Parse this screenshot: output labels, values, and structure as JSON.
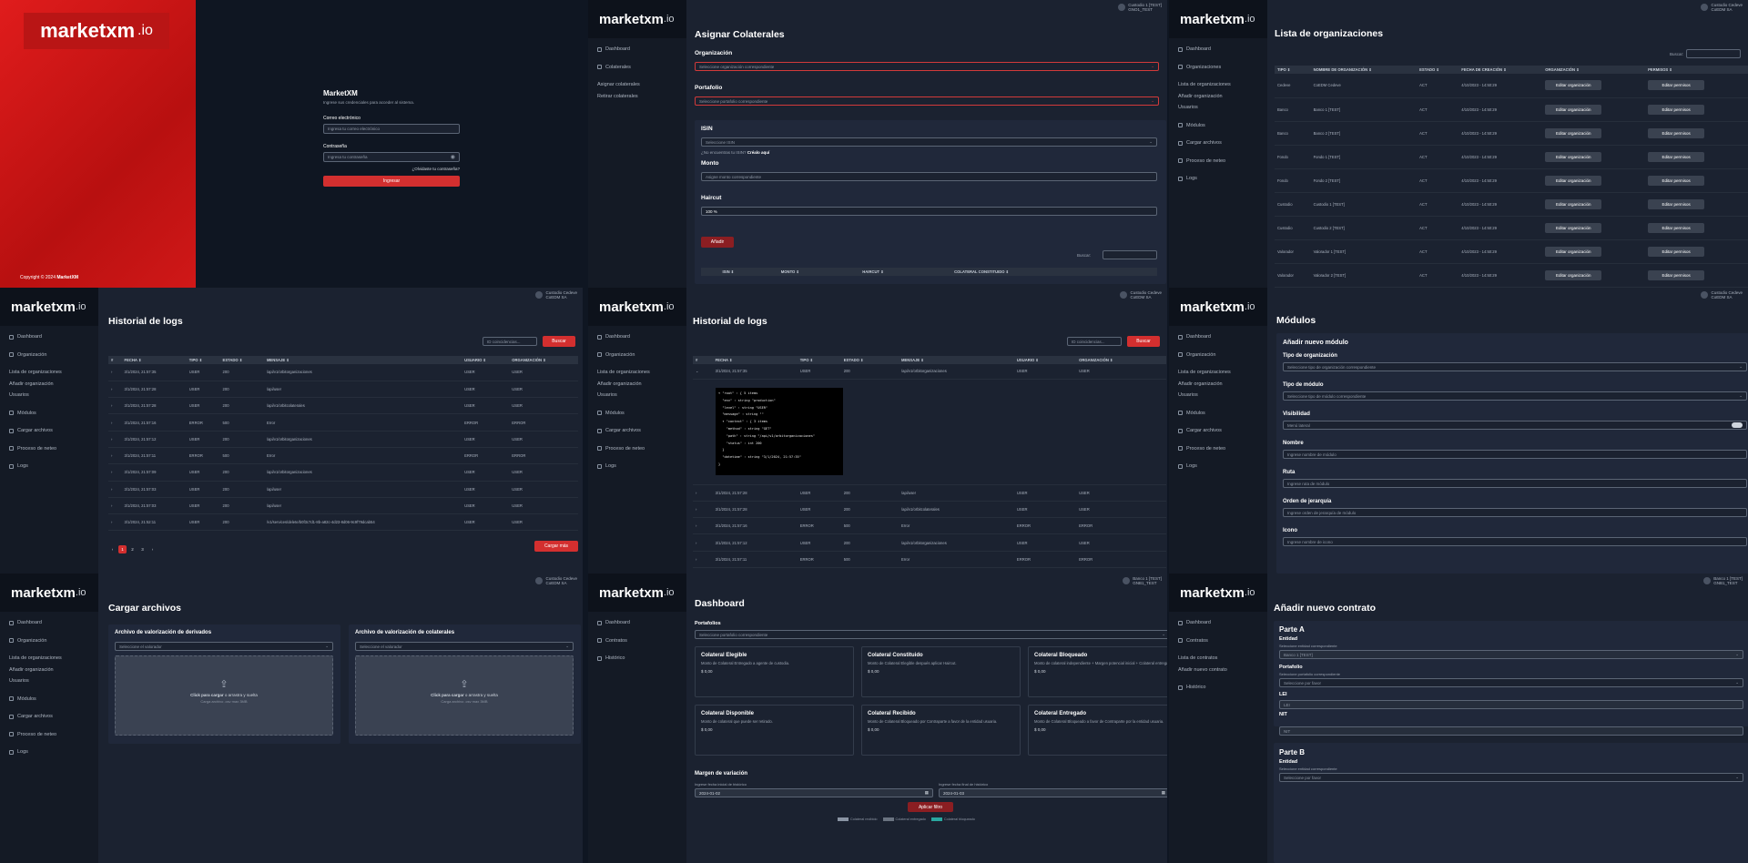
{
  "brand": {
    "name": "marketxm",
    "x": "x",
    "io": ".io"
  },
  "login": {
    "logo_name": "marketxm",
    "logo_io": ".io",
    "copyright": "Copyright © 2024",
    "copyright_brand": "MarketXM",
    "title": "MarketXM",
    "subtitle": "Ingrese sus credenciales para acceder al sistema.",
    "email_label": "Correo electrónico",
    "email_placeholder": "Ingresa tu correo electrónico",
    "password_label": "Contraseña",
    "password_placeholder": "Ingresa tu contraseña",
    "forgot": "¿Olvidaste tu contraseña?",
    "submit": "Ingresar"
  },
  "asignar": {
    "user_name": "Custodio 1 [TEST]",
    "user_org": "GNO1_TEST",
    "nav": [
      "Dashboard",
      "Colaterales",
      "Asignar colaterales",
      "Retirar colaterales"
    ],
    "title": "Asignar Colaterales",
    "org_label": "Organización",
    "org_placeholder": "Seleccione organización correspondiente",
    "port_label": "Portafolio",
    "port_placeholder": "Seleccione portafolio correspondiente",
    "isin_label": "ISIN",
    "isin_placeholder": "Seleccione ISIN",
    "isin_help": "¿No encuentras tu ISIN?",
    "isin_link": "Créalo aquí",
    "monto_label": "Monto",
    "monto_placeholder": "Asigne monto correspondiente",
    "haircut_label": "Haircut",
    "haircut_value": "100 %",
    "add": "Añadir",
    "search_label": "Buscar:",
    "cols": [
      "",
      "ISIN ⇕",
      "MONTO ⇕",
      "HAIRCUT ⇕",
      "COLATERAL CONSTITUIDO ⇕"
    ]
  },
  "orgs": {
    "user_name": "Custodio Cedeve",
    "user_org": "CoEDM SA",
    "nav": [
      "Dashboard",
      "Organizaciones",
      "Lista de organizaciones",
      "Añadir organización",
      "Usuarios",
      "Módulos",
      "Cargar archivos",
      "Proceso de neteo",
      "Logs"
    ],
    "title": "Lista de organizaciones",
    "search_label": "Buscar:",
    "cols": [
      "TIPO ⇕",
      "NOMBRE DE ORGANIZACIÓN ⇕",
      "ESTADO ⇕",
      "FECHA DE CREACIÓN ⇕",
      "ORGANIZACIÓN ⇕",
      "PERMISOS ⇕"
    ],
    "rows": [
      [
        "Cedeve",
        "CoEDM Cedeve",
        "ACT",
        "4/10/2023 - 14:50:29"
      ],
      [
        "Banco",
        "Banco 1 [TEST]",
        "ACT",
        "4/10/2023 - 14:50:29"
      ],
      [
        "Banco",
        "Banco 2 [TEST]",
        "ACT",
        "4/10/2023 - 14:50:29"
      ],
      [
        "Fondo",
        "Fondo 1 [TEST]",
        "ACT",
        "4/10/2023 - 14:50:29"
      ],
      [
        "Fondo",
        "Fondo 2 [TEST]",
        "ACT",
        "4/10/2023 - 14:50:29"
      ],
      [
        "Custodio",
        "Custodio 1 [TEST]",
        "ACT",
        "4/10/2023 - 14:50:29"
      ],
      [
        "Custodio",
        "Custodio 2 [TEST]",
        "ACT",
        "4/10/2023 - 14:50:29"
      ],
      [
        "Valorador",
        "Valorador 1 [TEST]",
        "ACT",
        "4/10/2023 - 14:50:29"
      ],
      [
        "Valorador",
        "Valorador 2 [TEST]",
        "ACT",
        "4/10/2023 - 14:50:29"
      ]
    ],
    "edit_org": "Editar organización",
    "edit_perm": "Editar permisos"
  },
  "logs1": {
    "user_name": "Custodio Cedeve",
    "user_org": "CoEDM SA",
    "nav": [
      "Dashboard",
      "Organización",
      "Lista de organizaciones",
      "Añadir organización",
      "Usuarios",
      "Módulos",
      "Cargar archivos",
      "Proceso de neteo",
      "Logs"
    ],
    "title": "Historial de logs",
    "search_placeholder": "ID coincidencias...",
    "search_btn": "Buscar",
    "cols": [
      "#",
      "FECHA ⇕",
      "TIPO ⇕",
      "ESTADO ⇕",
      "MENSAJE ⇕",
      "USUARIO ⇕",
      "ORGANIZACIÓN ⇕"
    ],
    "rows": [
      [
        "›",
        "3/1/2024, 21:57:35",
        "USER",
        "200",
        "/api/v1/orbitorganizaciones",
        "USER",
        "USER"
      ],
      [
        "›",
        "3/1/2024, 21:57:28",
        "USER",
        "200",
        "/api/user",
        "USER",
        "USER"
      ],
      [
        "›",
        "3/1/2024, 21:57:28",
        "USER",
        "200",
        "/api/v1/orbitcolaterales",
        "USER",
        "USER"
      ],
      [
        "›",
        "3/1/2024, 21:57:16",
        "ERROR",
        "500",
        "Error",
        "ERROR",
        "ERROR"
      ],
      [
        "›",
        "3/1/2024, 21:57:12",
        "USER",
        "200",
        "/api/v1/orbitorganizaciones",
        "USER",
        "USER"
      ],
      [
        "›",
        "3/1/2024, 21:57:11",
        "ERROR",
        "500",
        "Error",
        "ERROR",
        "ERROR"
      ],
      [
        "›",
        "3/1/2024, 21:57:09",
        "USER",
        "200",
        "/api/v1/orbitorganizaciones",
        "USER",
        "USER"
      ],
      [
        "›",
        "3/1/2024, 21:57:03",
        "USER",
        "200",
        "/api/user",
        "USER",
        "USER"
      ],
      [
        "›",
        "3/1/2024, 21:57:03",
        "USER",
        "200",
        "/api/user",
        "USER",
        "USER"
      ],
      [
        "›",
        "3/1/2024, 21:52:11",
        "USER",
        "200",
        "/v1/services/delete/b0f3c7d1-8b-a82c-4d23-8d06-9c9f79dcab54",
        "USER",
        "USER"
      ]
    ],
    "pages": [
      "‹",
      "1",
      "2",
      "3",
      "›"
    ],
    "download": "Cargar más"
  },
  "logs2": {
    "user_name": "Custodio Cedeve",
    "user_org": "CoEDM SA",
    "nav": [
      "Dashboard",
      "Organización",
      "Lista de organizaciones",
      "Añadir organización",
      "Usuarios",
      "Módulos",
      "Cargar archivos",
      "Proceso de neteo",
      "Logs"
    ],
    "title": "Historial de logs",
    "search_placeholder": "ID coincidencias...",
    "search_btn": "Buscar",
    "cols": [
      "#",
      "FECHA ⇕",
      "TIPO ⇕",
      "ESTADO ⇕",
      "MENSAJE ⇕",
      "USUARIO ⇕",
      "ORGANIZACIÓN ⇕"
    ],
    "first": [
      "⌄",
      "3/1/2024, 21:57:35",
      "USER",
      "200",
      "/api/v1/orbitorganizaciones",
      "USER",
      "USER"
    ],
    "json": [
      "▾ \"root\" : { 5 items",
      "  \"env\" : string \"production\"",
      "  \"level\" : string \"USER\"",
      "  \"message\" : string \"\"",
      "  ▾ \"context\" : { 3 items",
      "    \"method\" : string \"GET\"",
      "    \"path\" : string \"/api/v1/orbitorganizaciones\"",
      "    \"status\" : int 200",
      "  }",
      "  \"datetime\" : string \"3/1/2024, 21:57:35\"",
      "}"
    ],
    "rows": [
      [
        "›",
        "3/1/2024, 21:57:28",
        "USER",
        "200",
        "/api/user",
        "USER",
        "USER"
      ],
      [
        "›",
        "3/1/2024, 21:57:28",
        "USER",
        "200",
        "/api/v1/orbitcolaterales",
        "USER",
        "USER"
      ],
      [
        "›",
        "3/1/2024, 21:57:16",
        "ERROR",
        "500",
        "Error",
        "ERROR",
        "ERROR"
      ],
      [
        "›",
        "3/1/2024, 21:57:12",
        "USER",
        "200",
        "/api/v1/orbitorganizaciones",
        "USER",
        "USER"
      ],
      [
        "›",
        "3/1/2024, 21:57:11",
        "ERROR",
        "500",
        "Error",
        "ERROR",
        "ERROR"
      ],
      [
        "›",
        "3/1/2024, 21:57:09",
        "USER",
        "200",
        "/api/v1/orbitorganizaciones",
        "USER",
        "USER"
      ]
    ]
  },
  "modulos": {
    "user_name": "Custodio Cedeve",
    "user_org": "CoEDM SA",
    "nav": [
      "Dashboard",
      "Organización",
      "Lista de organizaciones",
      "Añadir organización",
      "Usuarios",
      "Módulos",
      "Cargar archivos",
      "Proceso de neteo",
      "Logs"
    ],
    "title": "Módulos",
    "card_title": "Añadir nuevo módulo",
    "fields": [
      {
        "label": "Tipo de organización",
        "ph": "Seleccione tipo de organización correspondiente",
        "select": true
      },
      {
        "label": "Tipo de módulo",
        "ph": "Seleccione tipo de módulo correspondiente",
        "select": true
      },
      {
        "label": "Visibilidad",
        "ph": "Menú lateral",
        "toggle": true
      },
      {
        "label": "Nombre",
        "ph": "Ingrese nombre de módulo"
      },
      {
        "label": "Ruta",
        "ph": "Ingrese ruta de módulo"
      },
      {
        "label": "Orden de jerarquía",
        "ph": "Ingrese orden de jerarquía de módulo"
      },
      {
        "label": "Icono",
        "ph": "Ingrese nombre de icono"
      }
    ]
  },
  "cargar": {
    "user_name": "Custodio Cedeve",
    "user_org": "CoEDM SA",
    "nav": [
      "Dashboard",
      "Organización",
      "Lista de organizaciones",
      "Añadir organización",
      "Usuarios",
      "Módulos",
      "Cargar archivos",
      "Proceso de neteo",
      "Logs"
    ],
    "title": "Cargar archivos",
    "card1": "Archivo de valorización de derivados",
    "card2": "Archivo de valorización de colaterales",
    "select_ph": "Seleccione el valorador",
    "drop_main": "Click para cargar",
    "drop_or": "o arrastra y suelta",
    "drop_sub": "Carga archivo .csv max 3MB"
  },
  "dashboard": {
    "user_name": "Banco 1 [TEST]",
    "user_org": "GNB1_TEST",
    "nav": [
      "Dashboard",
      "Contratos",
      "Histórico"
    ],
    "title": "Dashboard",
    "portfolio_label": "Portafolios",
    "portfolio_ph": "Seleccione portafolio correspondiente",
    "cards": [
      {
        "t": "Colateral Elegible",
        "d": "Monto de Colateral Entregado a agente de custodia.",
        "v": "$ 0,00"
      },
      {
        "t": "Colateral Constituido",
        "d": "Monto de Colateral Elegible después aplicar Haircut.",
        "v": "$ 0,00"
      },
      {
        "t": "Colateral Bloqueado",
        "d": "Monto de colateral independiente + Margen potencial inicial + Colateral entregado.",
        "v": "$ 0,00"
      },
      {
        "t": "Colateral Disponible",
        "d": "Monto de colateral que puede ser retirado.",
        "v": "$ 0,00"
      },
      {
        "t": "Colateral Recibido",
        "d": "Monto de Colateral Bloqueado por Contraparte a favor de la entidad usuaria.",
        "v": "$ 0,00"
      },
      {
        "t": "Colateral Entregado",
        "d": "Monto de Colateral Bloqueado a favor de Contraparte por la entidad usuaria.",
        "v": "$ 0,00"
      }
    ],
    "margin_title": "Margen de variación",
    "start_label": "Ingrese fecha inicial de histórico",
    "start_value": "2024-01-02",
    "end_label": "Ingrese fecha final de histórico",
    "end_value": "2024-01-03",
    "apply": "Aplicar filtro",
    "legend": [
      "Colateral recibido",
      "Colateral entregado",
      "Colateral bloqueado"
    ],
    "legend_colors": [
      "#8a94a3",
      "#6a7380",
      "#2aa7a0"
    ]
  },
  "contrato": {
    "user_name": "Banco 1 [TEST]",
    "user_org": "GNB1_TEST",
    "nav": [
      "Dashboard",
      "Contratos",
      "Lista de contratos",
      "Añadir nuevo contrato",
      "Histórico"
    ],
    "title": "Añadir nuevo contrato",
    "partA": "Parte A",
    "entidad": "Entidad",
    "entidad_help": "Seleccione entidad correspondiente",
    "entidad_value": "Banco 1 [TEST]",
    "portafolio": "Portafolio",
    "portafolio_help": "Seleccione portafolio correspondiente",
    "portafolio_ph": "Seleccione por favor",
    "lei": "LEI",
    "lei_ph": "LEI",
    "nit": "NIT",
    "nit_ph": "NIT",
    "partB": "Parte B",
    "entidadB": "Entidad",
    "entidadB_help": "Seleccione entidad correspondiente",
    "entidadB_ph": "Seleccione por favor"
  }
}
